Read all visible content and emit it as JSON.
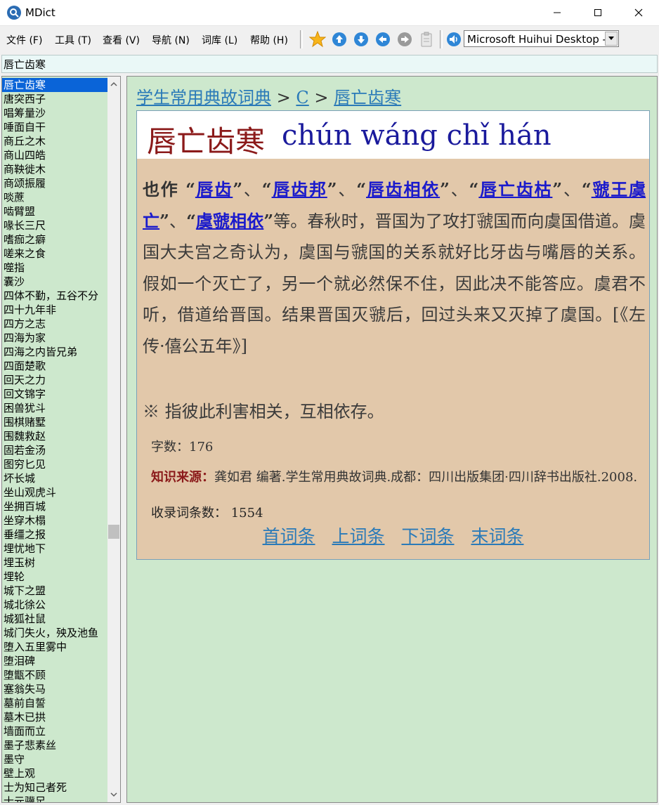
{
  "window": {
    "title": "MDict"
  },
  "menu": [
    {
      "label": "文件 (F)"
    },
    {
      "label": "工具 (T)"
    },
    {
      "label": "查看 (V)"
    },
    {
      "label": "导航 (N)"
    },
    {
      "label": "词库 (L)"
    },
    {
      "label": "帮助 (H)"
    }
  ],
  "toolbar": {
    "icons": [
      "star-icon",
      "arrow-up-icon",
      "arrow-down-icon",
      "arrow-left-icon",
      "arrow-right-icon",
      "clipboard-icon",
      "speaker-icon"
    ],
    "dictionary_select": "Microsoft Huihui Desktop -"
  },
  "search": {
    "value": "唇亡齿寒"
  },
  "word_list": [
    "唇亡齿寒",
    "唐突西子",
    "唱筹量沙",
    "唾面自干",
    "商丘之木",
    "商山四皓",
    "商鞅徙木",
    "商颂振履",
    "啖蔗",
    "啮臂盟",
    "喙长三尺",
    "嗜痂之癖",
    "嗟来之食",
    "噬指",
    "囊沙",
    "四体不勤，五谷不分",
    "四十九年非",
    "四方之志",
    "四海为家",
    "四海之内皆兄弟",
    "四面楚歌",
    "回天之力",
    "回文锦字",
    "困兽犹斗",
    "围棋赌墅",
    "围魏救赵",
    "固若金汤",
    "图穷匕见",
    "坏长城",
    "坐山观虎斗",
    "坐拥百城",
    "坐穿木榻",
    "垂缰之报",
    "埋忧地下",
    "埋玉树",
    "埋轮",
    "城下之盟",
    "城北徐公",
    "城狐社鼠",
    "城门失火，殃及池鱼",
    "堕入五里雾中",
    "堕泪碑",
    "堕甑不顾",
    "塞翁失马",
    "墓前自誓",
    "墓木已拱",
    "墙面而立",
    "墨子悲素丝",
    "墨守",
    "壁上观",
    "士为知己者死",
    "士元骥足"
  ],
  "entry": {
    "breadcrumb": {
      "dict": "学生常用典故词典",
      "sep1": ">",
      "letter": "C",
      "sep2": ">",
      "word": "唇亡齿寒"
    },
    "headword": "唇亡齿寒",
    "pinyin": "chún wáng chǐ hán",
    "also": "也作",
    "q_open": "“",
    "q_close": "”",
    "sep": "、",
    "variants": [
      "唇齿",
      "唇齿邦",
      "唇齿相依",
      "唇亡齿枯",
      "虢王虞亡",
      "虞虢相依"
    ],
    "body_tail": "等。春秋时，晋国为了攻打虢国而向虞国借道。虞国大夫宫之奇认为，虞国与虢国的关系就好比牙齿与嘴唇的关系。假如一个灭亡了，另一个就必然保不住，因此决不能答应。虞君不听，借道给晋国。结果晋国灭虢后，回过头来又灭掉了虞国。[《左传·僖公五年》]",
    "meaning": "※ 指彼此利害相关，互相依存。",
    "word_count": "字数：176",
    "source_label": "知识来源：",
    "source_text": "龚如君 编著.学生常用典故词典.成都：四川出版集团·四川辞书出版社.2008.",
    "entries_count": "收录词条数：  1554",
    "nav": {
      "first": "首词条",
      "prev": "上词条",
      "next": "下词条",
      "last": "末词条"
    }
  },
  "colors": {
    "list_bg": "#cde8cd",
    "selection": "#0a64d8",
    "card_bg": "#e2c8aa",
    "headword": "#8b1a1a",
    "pinyin": "#1a1a9c",
    "link": "#2a7ab8"
  }
}
